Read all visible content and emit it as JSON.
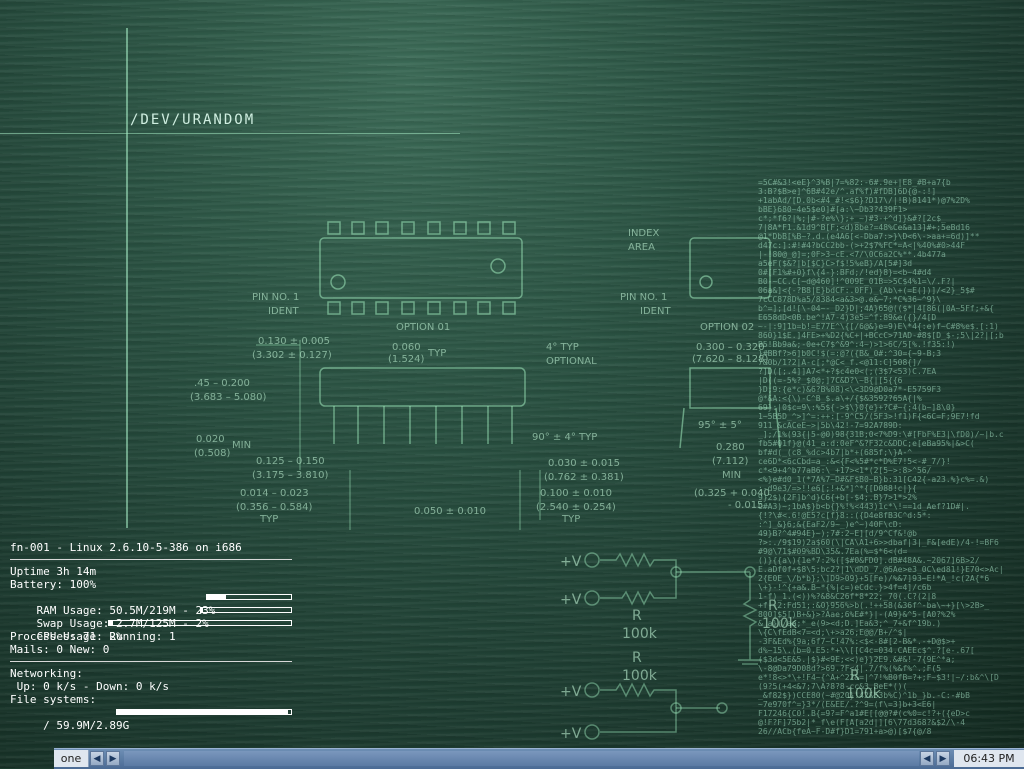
{
  "wallpaper": {
    "label": "/DEV/URANDOM",
    "schematic_text": {
      "pin1": "PIN NO. 1",
      "ident": "IDENT",
      "option1": "OPTION 01",
      "option2": "OPTION 02",
      "index": "INDEX",
      "area": "AREA",
      "pin1b": "PIN NO. 1",
      "identb": "IDENT",
      "d1": "0.130 ± 0.005",
      "d1b": "(3.302 ± 0.127)",
      "d2": "0.060",
      "d2b": "(1.524)",
      "typ": "TYP",
      "deg4": "4° TYP",
      "optional": "OPTIONAL",
      "d3": "0.300 – 0.320",
      "d3b": "(7.620 – 8.128)",
      "d4": ".45 – 0.200",
      "d4b": "(3.683 – 5.080)",
      "d5": "0.020",
      "d5b": "(0.508)",
      "min": "MIN",
      "d6": "0.125 – 0.150",
      "d6b": "(3.175 – 3.810)",
      "d7": "0.014 – 0.023",
      "d7b": "(0.356 – 0.584)",
      "typ2": "TYP",
      "deg90": "90° ± 4° TYP",
      "d8": "0.030 ± 0.015",
      "d8b": "(0.762 ± 0.381)",
      "d9": "0.100 ± 0.010",
      "d9b": "(2.540 ± 0.254)",
      "typ3": "TYP",
      "d10": "0.050 ± 0.010",
      "deg95": "95° ± 5°",
      "d11": "0.280",
      "d11b": "(7.112)",
      "min2": "MIN",
      "d12": "(0.325 + 0.040",
      "d12b": "- 0.015",
      "v1": "+V",
      "v2": "+V",
      "v3": "+V",
      "v4": "+V",
      "r": "R",
      "k100": "100k",
      "r2": "R",
      "k100b": "100k",
      "r3": "R",
      "k100c": "100k",
      "r4": "R",
      "k100d": "100k"
    }
  },
  "conky": {
    "header": "fn-001 - Linux 2.6.10-5-386 on i686",
    "uptime": "Uptime 3h 14m",
    "battery": "Battery: 100%",
    "ram": "RAM Usage: 50.5M/219M - 23%",
    "ram_pct": 0.23,
    "swap": "Swap Usage: 2.7M/125M - 2%",
    "swap_pct": 0.02,
    "cpu": "CPU Usage: 2%",
    "cpu_pct": 0.02,
    "processes": "Processes: 71  Running: 1",
    "mails": "Mails: 0 New: 0",
    "networking": "Networking:",
    "net_line": " Up: 0 k/s - Down: 0 k/s",
    "fs_title": "File systems:",
    "fs_line": " / 59.9M/2.89G",
    "fs_pct": 0.98
  },
  "taskbar": {
    "desktop_label": "one",
    "left_arrow": "◀",
    "right_arrow": "▶",
    "clock": "06:43 PM"
  },
  "colors": {
    "background": "#1d3c2f",
    "taskbar": "#5b7aa3",
    "text": "#ffffff"
  }
}
